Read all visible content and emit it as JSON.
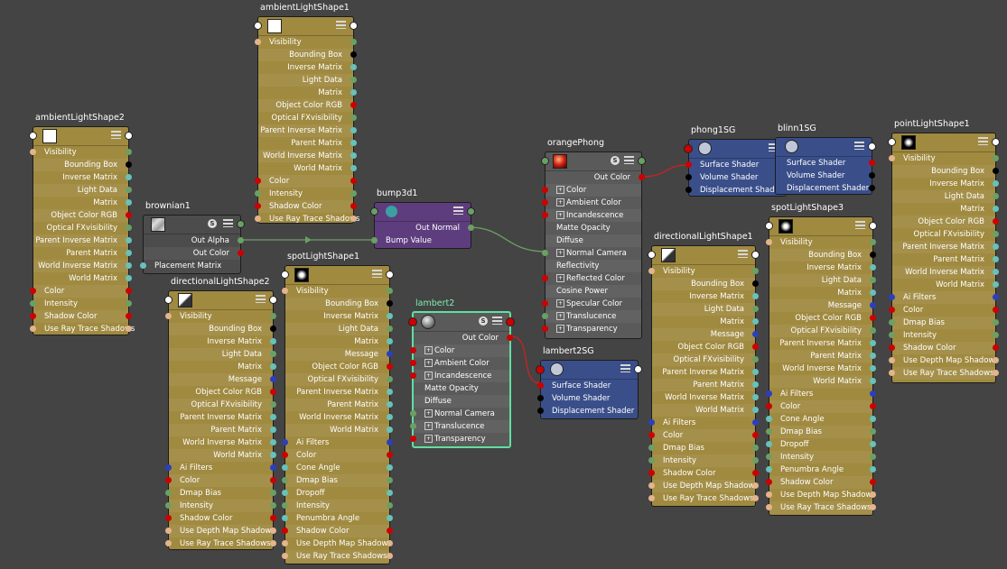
{
  "colors": {
    "background": "#444444",
    "light_node": "#a08a40",
    "shader_node": "#5a5a5a",
    "util_node": "#4c4c4c",
    "bump_node": "#5e3d7e",
    "sg_node": "#3a4f8a",
    "selected_border": "#5fe0a0",
    "port_red": "#cc0000",
    "port_green": "#6aa063",
    "port_blue": "#2a3fc0",
    "port_peach": "#e4b48c",
    "port_black": "#000000",
    "port_white": "#ffffff",
    "port_teal": "#66c2bb"
  },
  "nodes": {
    "ambientLightShape1": {
      "title": "ambientLightShape1",
      "swatch": "white-square",
      "attrs": [
        "Visibility",
        "Bounding Box",
        "Inverse Matrix",
        "Light Data",
        "Matrix",
        "Object Color RGB",
        "Optical FXvisibility",
        "Parent Inverse Matrix",
        "Parent Matrix",
        "World Inverse Matrix",
        "World Matrix",
        "Color",
        "Intensity",
        "Shadow Color",
        "Use Ray Trace Shadows"
      ]
    },
    "ambientLightShape2": {
      "title": "ambientLightShape2",
      "swatch": "white-square",
      "attrs": [
        "Visibility",
        "Bounding Box",
        "Inverse Matrix",
        "Light Data",
        "Matrix",
        "Object Color RGB",
        "Optical FXvisibility",
        "Parent Inverse Matrix",
        "Parent Matrix",
        "World Inverse Matrix",
        "World Matrix",
        "Color",
        "Intensity",
        "Shadow Color",
        "Use Ray Trace Shadows"
      ]
    },
    "brownian1": {
      "title": "brownian1",
      "attrs": [
        "Out Alpha",
        "Out Color",
        "Placement Matrix"
      ]
    },
    "bump3d1": {
      "title": "bump3d1",
      "attrs": [
        "Out Normal",
        "Bump Value"
      ]
    },
    "directionalLightShape2": {
      "title": "directionalLightShape2",
      "attrs": [
        "Visibility",
        "Bounding Box",
        "Inverse Matrix",
        "Light Data",
        "Matrix",
        "Message",
        "Object Color RGB",
        "Optical FXvisibility",
        "Parent Inverse Matrix",
        "Parent Matrix",
        "World Inverse Matrix",
        "World Matrix",
        "Ai Filters",
        "Color",
        "Dmap Bias",
        "Intensity",
        "Shadow Color",
        "Use Depth Map Shadows",
        "Use Ray Trace Shadows"
      ]
    },
    "spotLightShape1": {
      "title": "spotLightShape1",
      "attrs": [
        "Visibility",
        "Bounding Box",
        "Inverse Matrix",
        "Light Data",
        "Matrix",
        "Message",
        "Object Color RGB",
        "Optical FXvisibility",
        "Parent Inverse Matrix",
        "Parent Matrix",
        "World Inverse Matrix",
        "World Matrix",
        "Ai Filters",
        "Color",
        "Cone Angle",
        "Dmap Bias",
        "Dropoff",
        "Intensity",
        "Penumbra Angle",
        "Shadow Color",
        "Use Depth Map Shadows",
        "Use Ray Trace Shadows"
      ]
    },
    "lambert2": {
      "title": "lambert2",
      "attrs": [
        "Out Color",
        "Color",
        "Ambient Color",
        "Incandescence",
        "Matte Opacity",
        "Diffuse",
        "Normal Camera",
        "Translucence",
        "Transparency"
      ]
    },
    "orangePhong": {
      "title": "orangePhong",
      "attrs": [
        "Out Color",
        "Color",
        "Ambient Color",
        "Incandescence",
        "Matte Opacity",
        "Diffuse",
        "Normal Camera",
        "Reflectivity",
        "Reflected Color",
        "Cosine Power",
        "Specular Color",
        "Translucence",
        "Transparency"
      ]
    },
    "lambert2SG": {
      "title": "lambert2SG",
      "attrs": [
        "Surface Shader",
        "Volume Shader",
        "Displacement Shader"
      ]
    },
    "phong1SG": {
      "title": "phong1SG",
      "attrs": [
        "Surface Shader",
        "Volume Shader",
        "Displacement Shader"
      ]
    },
    "blinn1SG": {
      "title": "blinn1SG",
      "attrs": [
        "Surface Shader",
        "Volume Shader",
        "Displacement Shader"
      ]
    },
    "directionalLightShape1": {
      "title": "directionalLightShape1",
      "attrs": [
        "Visibility",
        "Bounding Box",
        "Inverse Matrix",
        "Light Data",
        "Matrix",
        "Message",
        "Object Color RGB",
        "Optical FXvisibility",
        "Parent Inverse Matrix",
        "Parent Matrix",
        "World Inverse Matrix",
        "World Matrix",
        "Ai Filters",
        "Color",
        "Dmap Bias",
        "Intensity",
        "Shadow Color",
        "Use Depth Map Shadows",
        "Use Ray Trace Shadows"
      ]
    },
    "spotLightShape3": {
      "title": "spotLightShape3",
      "attrs": [
        "Visibility",
        "Bounding Box",
        "Inverse Matrix",
        "Light Data",
        "Matrix",
        "Message",
        "Object Color RGB",
        "Optical FXvisibility",
        "Parent Inverse Matrix",
        "Parent Matrix",
        "World Inverse Matrix",
        "World Matrix",
        "Ai Filters",
        "Color",
        "Cone Angle",
        "Dmap Bias",
        "Dropoff",
        "Intensity",
        "Penumbra Angle",
        "Shadow Color",
        "Use Depth Map Shadows",
        "Use Ray Trace Shadows"
      ]
    },
    "pointLightShape1": {
      "title": "pointLightShape1",
      "attrs": [
        "Visibility",
        "Bounding Box",
        "Inverse Matrix",
        "Light Data",
        "Matrix",
        "Object Color RGB",
        "Optical FXvisibility",
        "Parent Inverse Matrix",
        "Parent Matrix",
        "World Inverse Matrix",
        "World Matrix",
        "Ai Filters",
        "Color",
        "Dmap Bias",
        "Intensity",
        "Shadow Color",
        "Use Depth Map Shadows",
        "Use Ray Trace Shadows"
      ]
    }
  }
}
